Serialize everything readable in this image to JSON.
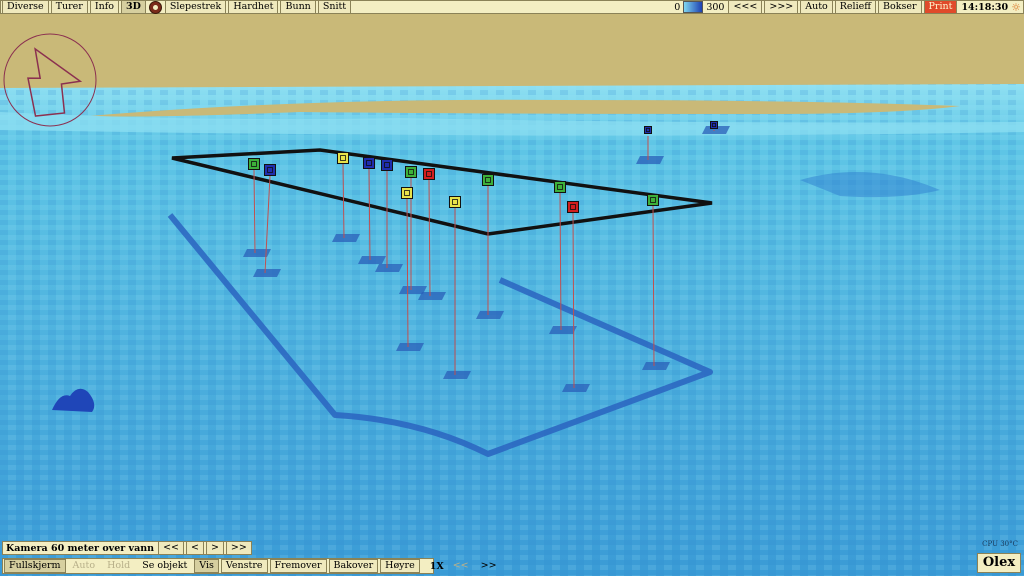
{
  "top_menu": {
    "left": [
      "Diverse",
      "Turer",
      "Info",
      "3D"
    ],
    "left2": [
      "Slepestrek",
      "Hardhet",
      "Bunn",
      "Snitt"
    ],
    "scale_min": "0",
    "scale_max": "300",
    "right": [
      "<<<",
      ">>>",
      "Auto",
      "Relieff",
      "Bokser"
    ],
    "print_label": "Print",
    "clock": "14:18:30"
  },
  "camera_bar": {
    "label": "Kamera 60 meter over vann",
    "buttons": [
      "<<",
      "<",
      ">",
      ">>"
    ]
  },
  "bottom_bar": {
    "items": [
      "Fullskjerm",
      "Auto",
      "Hold",
      "Se objekt",
      "Vis",
      "Venstre",
      "Fremover",
      "Bakover",
      "Høyre"
    ],
    "speed": "1X",
    "nav": [
      "<<",
      ">>"
    ]
  },
  "cpu_label": "CPU 30°C",
  "brand": "Olex",
  "colors": {
    "sea_light": "#5ec6e4",
    "sea_dark": "#2b6fc3",
    "land": "#c9b978",
    "toolbar": "#f3eec2",
    "marker_green": "#3db03a",
    "marker_yellow": "#e7e24a",
    "marker_blue": "#1f2fae",
    "marker_red": "#d21e1e"
  },
  "markers": [
    {
      "color": "green"
    },
    {
      "color": "blue"
    },
    {
      "color": "yellow"
    },
    {
      "color": "blue"
    },
    {
      "color": "blue"
    },
    {
      "color": "green"
    },
    {
      "color": "red"
    },
    {
      "color": "yellow"
    },
    {
      "color": "yellow"
    },
    {
      "color": "green"
    },
    {
      "color": "green"
    },
    {
      "color": "red"
    },
    {
      "color": "green"
    },
    {
      "color": "blue"
    },
    {
      "color": "blue"
    }
  ]
}
